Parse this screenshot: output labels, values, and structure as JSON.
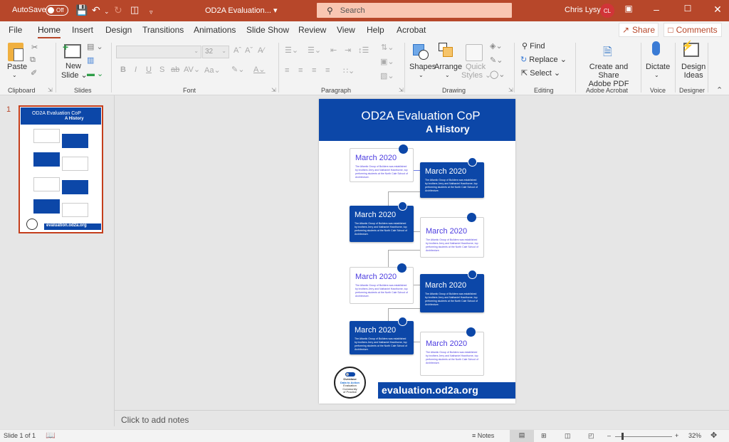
{
  "titlebar": {
    "autosave_label": "AutoSave",
    "autosave_state": "Off",
    "doc_title": "OD2A Evaluation...",
    "search_placeholder": "Search",
    "user_name": "Chris Lysy",
    "user_initials": "CL"
  },
  "tabs": [
    "File",
    "Home",
    "Insert",
    "Design",
    "Transitions",
    "Animations",
    "Slide Show",
    "Review",
    "View",
    "Help",
    "Acrobat"
  ],
  "active_tab": "Home",
  "share_label": "Share",
  "comments_label": "Comments",
  "ribbon": {
    "clipboard": {
      "label": "Clipboard",
      "paste": "Paste"
    },
    "slides": {
      "label": "Slides",
      "new_slide_1": "New",
      "new_slide_2": "Slide"
    },
    "font": {
      "label": "Font",
      "size": "32"
    },
    "paragraph": {
      "label": "Paragraph"
    },
    "drawing": {
      "label": "Drawing",
      "shapes": "Shapes",
      "arrange": "Arrange",
      "quick_styles_1": "Quick",
      "quick_styles_2": "Styles"
    },
    "editing": {
      "label": "Editing",
      "find": "Find",
      "replace": "Replace",
      "select": "Select"
    },
    "acrobat": {
      "label": "Adobe Acrobat",
      "create_1": "Create and Share",
      "create_2": "Adobe PDF"
    },
    "voice": {
      "label": "Voice",
      "dictate": "Dictate"
    },
    "designer": {
      "label": "Designer",
      "design_1": "Design",
      "design_2": "Ideas"
    }
  },
  "thumbnail": {
    "number": "1"
  },
  "slide": {
    "title": "OD2A Evaluation CoP",
    "subtitle": "A History",
    "cards": [
      {
        "date": "March 2020",
        "desc": "The Atlantic Group of Builders was established by brothers Jerry and Nathaniel Hawthorne, top performing students at the North Cale School of Architecture.",
        "style": "white"
      },
      {
        "date": "March 2020",
        "desc": "The Atlantic Group of Builders was established by brothers Jerry and Nathaniel Hawthorne, top performing students at the North Cale School of Architecture.",
        "style": "blue"
      },
      {
        "date": "March 2020",
        "desc": "The Atlantic Group of Builders was established by brothers Jerry and Nathaniel Hawthorne, top performing students at the North Cale School of Architecture.",
        "style": "blue"
      },
      {
        "date": "March 2020",
        "desc": "The Atlantic Group of Builders was established by brothers Jerry and Nathaniel Hawthorne, top performing students at the North Cale School of Architecture.",
        "style": "white"
      },
      {
        "date": "March 2020",
        "desc": "The Atlantic Group of Builders was established by brothers Jerry and Nathaniel Hawthorne, top performing students at the North Cale School of Architecture.",
        "style": "white"
      },
      {
        "date": "March 2020",
        "desc": "The Atlantic Group of Builders was established by brothers Jerry and Nathaniel Hawthorne, top performing students at the North Cale School of Architecture.",
        "style": "blue"
      },
      {
        "date": "March 2020",
        "desc": "The Atlantic Group of Builders was established by brothers Jerry and Nathaniel Hawthorne, top performing students at the North Cale School of Architecture.",
        "style": "blue"
      },
      {
        "date": "March 2020",
        "desc": "The Atlantic Group of Builders was established by brothers Jerry and Nathaniel Hawthorne, top performing students at the North Cale School of Architecture.",
        "style": "white"
      }
    ],
    "logo": {
      "line1": "Overdose",
      "line2a": "Data",
      "line2b": "to Action",
      "line3": "Evaluation",
      "line4": "Community",
      "line5": "of Practice"
    },
    "footer_url": "evaluation.od2a.org"
  },
  "notes_placeholder": "Click to add notes",
  "status": {
    "slide_info": "Slide 1 of 1",
    "notes_label": "Notes",
    "zoom_level": "32%"
  },
  "colors": {
    "brand": "#b7472a",
    "slide_blue": "#0c47a8",
    "date_purple": "#4b3be0"
  }
}
